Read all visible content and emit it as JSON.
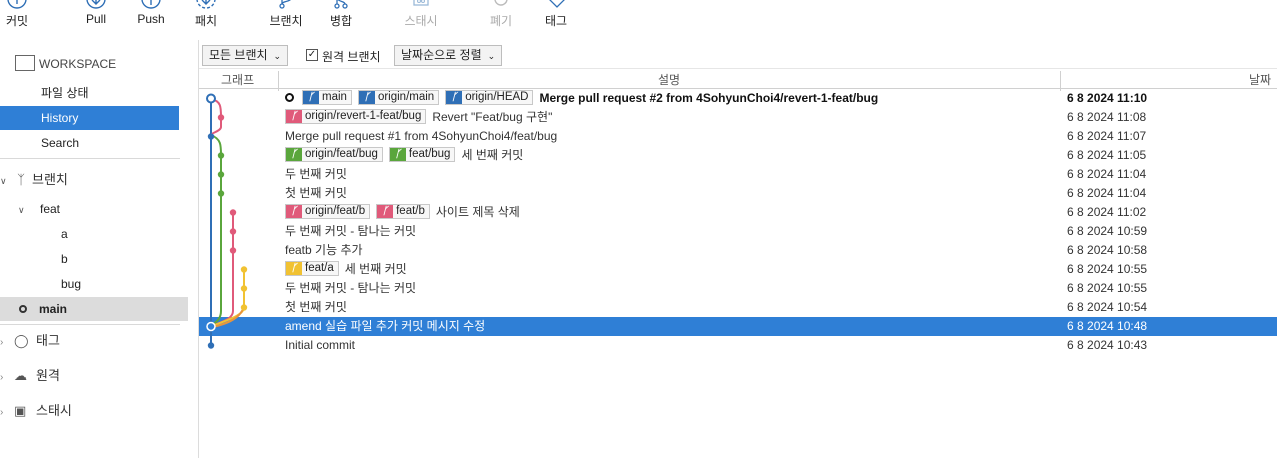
{
  "toolbar": {
    "commit": "커밋",
    "pull": "Pull",
    "push": "Push",
    "patch": "패치",
    "branch": "브랜치",
    "merge": "병합",
    "stash": "스태시",
    "discard": "폐기",
    "tag": "태그"
  },
  "sidebar": {
    "workspace": "WORKSPACE",
    "file_status": "파일 상태",
    "history": "History",
    "search": "Search",
    "branches": "브랜치",
    "feat_folder": "feat",
    "feat_a": "a",
    "feat_b": "b",
    "feat_bug": "bug",
    "main": "main",
    "tags": "태그",
    "remotes": "원격",
    "stashes": "스태시"
  },
  "filter": {
    "all_branches": "모든 브랜치",
    "remote_branches": "원격 브랜치",
    "remote_checked": true,
    "sort": "날짜순으로 정렬"
  },
  "columns": {
    "graph": "그래프",
    "description": "설명",
    "date": "날짜"
  },
  "colors": {
    "accent": "#2f7fd6",
    "lane_blue": "#2f6fb6",
    "lane_pink": "#e05a7a",
    "lane_green": "#5aa63c",
    "lane_yellow": "#f1c232",
    "lane_orange": "#e8953c"
  },
  "commits": [
    {
      "refs": [
        {
          "name": "main",
          "color": "#2f6fb6"
        },
        {
          "name": "origin/main",
          "color": "#2f6fb6"
        },
        {
          "name": "origin/HEAD",
          "color": "#2f6fb6"
        }
      ],
      "head": true,
      "message": "Merge pull request #2 from 4SohyunChoi4/revert-1-feat/bug",
      "date": "6 8 2024 11:10"
    },
    {
      "refs": [
        {
          "name": "origin/revert-1-feat/bug",
          "color": "#e05a7a"
        }
      ],
      "message": "Revert \"Feat/bug 구현\"",
      "date": "6 8 2024 11:08"
    },
    {
      "refs": [],
      "message": "Merge pull request #1 from 4SohyunChoi4/feat/bug",
      "date": "6 8 2024 11:07"
    },
    {
      "refs": [
        {
          "name": "origin/feat/bug",
          "color": "#5aa63c"
        },
        {
          "name": "feat/bug",
          "color": "#5aa63c"
        }
      ],
      "message": "세 번째 커밋",
      "date": "6 8 2024 11:05"
    },
    {
      "refs": [],
      "message": "두 번째 커밋",
      "date": "6 8 2024 11:04"
    },
    {
      "refs": [],
      "message": "첫 번째 커밋",
      "date": "6 8 2024 11:04"
    },
    {
      "refs": [
        {
          "name": "origin/feat/b",
          "color": "#e05a7a"
        },
        {
          "name": "feat/b",
          "color": "#e05a7a"
        }
      ],
      "message": "사이트 제목 삭제",
      "date": "6 8 2024 11:02"
    },
    {
      "refs": [],
      "message": "두 번째 커밋 - 탐나는 커밋",
      "date": "6 8 2024 10:59"
    },
    {
      "refs": [],
      "message": "featb 기능 추가",
      "date": "6 8 2024 10:58"
    },
    {
      "refs": [
        {
          "name": "feat/a",
          "color": "#f1c232"
        }
      ],
      "message": "세 번째 커밋",
      "date": "6 8 2024 10:55"
    },
    {
      "refs": [],
      "message": "두 번째 커밋 - 탐나는 커밋",
      "date": "6 8 2024 10:55"
    },
    {
      "refs": [],
      "message": "첫 번째 커밋",
      "date": "6 8 2024 10:54"
    },
    {
      "refs": [],
      "message": "amend 실습 파일 추가 커밋 메시지 수정",
      "date": "6 8 2024 10:48",
      "selected": true
    },
    {
      "refs": [],
      "message": "Initial commit",
      "date": "6 8 2024 10:43"
    }
  ]
}
